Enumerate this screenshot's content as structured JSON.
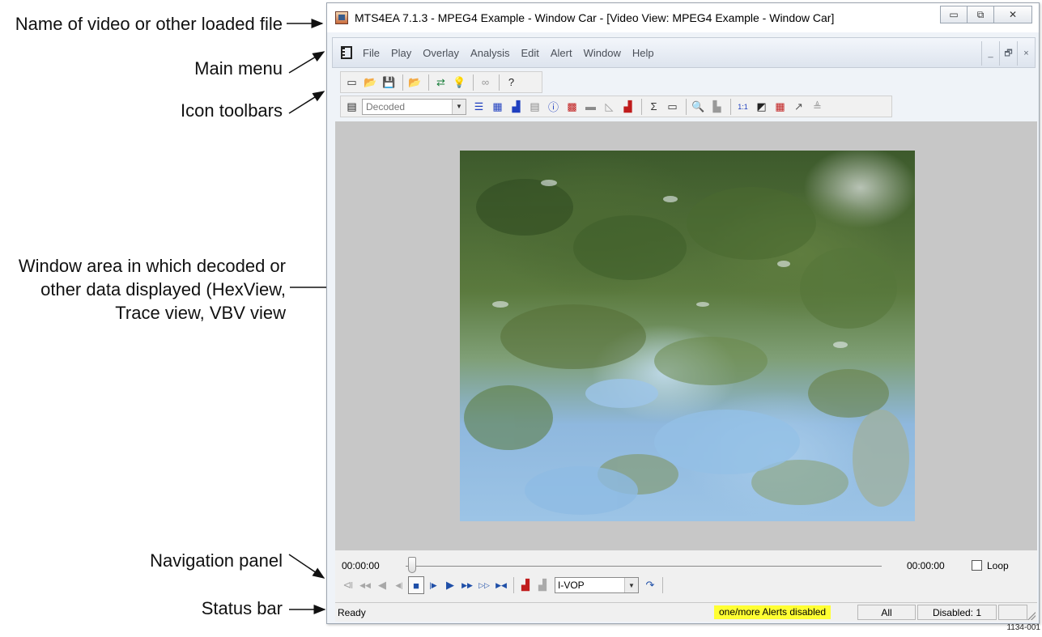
{
  "callouts": {
    "file_name": "Name of video or other loaded file",
    "main_menu": "Main menu",
    "icon_toolbars": "Icon toolbars",
    "window_area": [
      "Window area in which decoded or",
      "other data displayed (HexView,",
      "Trace view, VBV view"
    ],
    "navigation_panel": "Navigation panel",
    "status_bar": "Status bar"
  },
  "figure_id": "1134-001",
  "window": {
    "title": "MTS4EA 7.1.3 - MPEG4 Example - Window Car - [Video View: MPEG4 Example - Window Car]",
    "controls": {
      "minimize": "▭",
      "restore": "⧉",
      "close": "✕"
    }
  },
  "menu": {
    "items": [
      "File",
      "Play",
      "Overlay",
      "Analysis",
      "Edit",
      "Alert",
      "Window",
      "Help"
    ],
    "mdi_controls": {
      "minimize": "_",
      "restore": "🗗",
      "close": "×"
    }
  },
  "toolbar1": {
    "icons": [
      {
        "name": "new-file-icon",
        "glyph": "▭",
        "color": "#333333"
      },
      {
        "name": "open-folder-icon",
        "glyph": "📂",
        "color": "#333333"
      },
      {
        "name": "save-icon",
        "glyph": "💾",
        "color": "#222222"
      },
      {
        "name": "open-stream-icon",
        "glyph": "📂",
        "color": "#333333"
      },
      {
        "name": "compare-arrows-icon",
        "glyph": "⇄",
        "color": "#1a7f3c"
      },
      {
        "name": "bulb-icon",
        "glyph": "💡",
        "color": "#c9a400"
      },
      {
        "name": "link-icon",
        "glyph": "∞",
        "color": "#999999"
      },
      {
        "name": "help-icon",
        "glyph": "?",
        "color": "#222222"
      }
    ]
  },
  "toolbar2": {
    "view_select": {
      "value": "Decoded",
      "options_arrow": "▼"
    },
    "icons": [
      {
        "name": "list-view-icon",
        "glyph": "☰",
        "color": "#1f3fbf"
      },
      {
        "name": "hex-view-icon",
        "glyph": "▦",
        "color": "#1f3fbf"
      },
      {
        "name": "bits-chart-icon",
        "glyph": "▟",
        "color": "#1f3fbf"
      },
      {
        "name": "frame-grid-icon",
        "glyph": "▤",
        "color": "#888888"
      },
      {
        "name": "info-icon",
        "glyph": "ⓘ",
        "color": "#1f3fbf"
      },
      {
        "name": "macroblock-icon",
        "glyph": "▩",
        "color": "#c01c1c"
      },
      {
        "name": "layers-icon",
        "glyph": "▬",
        "color": "#8a8a8a"
      },
      {
        "name": "line-chart-icon",
        "glyph": "◺",
        "color": "#999999"
      },
      {
        "name": "bar-chart-icon",
        "glyph": "▟",
        "color": "#c01c1c"
      },
      {
        "name": "sigma-icon",
        "glyph": "Σ",
        "color": "#333333"
      },
      {
        "name": "comment-icon",
        "glyph": "▭",
        "color": "#333333"
      },
      {
        "name": "zoom-icon",
        "glyph": "🔍",
        "color": "#333333"
      },
      {
        "name": "factory-icon",
        "glyph": "▙",
        "color": "#999999"
      },
      {
        "name": "actual-size-icon",
        "glyph": "1:1",
        "color": "#1f3fbf"
      },
      {
        "name": "invert-icon",
        "glyph": "◩",
        "color": "#222222"
      },
      {
        "name": "red-grid-icon",
        "glyph": "▦",
        "color": "#c01c1c"
      },
      {
        "name": "export-icon",
        "glyph": "↗",
        "color": "#555555"
      },
      {
        "name": "print-icon",
        "glyph": "≜",
        "color": "#999999"
      }
    ]
  },
  "navigation": {
    "time_start": "00:00:00",
    "time_end": "00:00:00",
    "position": 0,
    "loop_label": "Loop",
    "loop_checked": false,
    "buttons": [
      {
        "name": "go-to-start-button",
        "glyph": "⧏",
        "dim": true
      },
      {
        "name": "rewind-fast-button",
        "glyph": "◀◀",
        "dim": true
      },
      {
        "name": "rewind-button",
        "glyph": "◀",
        "dim": true
      },
      {
        "name": "step-back-button",
        "glyph": "◀|",
        "dim": true
      },
      {
        "name": "stop-button",
        "glyph": "■",
        "stop": true
      },
      {
        "name": "step-forward-button",
        "glyph": "|▶"
      },
      {
        "name": "play-button",
        "glyph": "▶"
      },
      {
        "name": "fast-forward-button",
        "glyph": "▶▶"
      },
      {
        "name": "slow-forward-button",
        "glyph": "▷▷"
      },
      {
        "name": "go-to-end-button",
        "glyph": "▶◀"
      }
    ],
    "frame_buttons": [
      {
        "name": "frame-bits-button",
        "glyph": "▟"
      },
      {
        "name": "frame-chart-button",
        "glyph": "▟",
        "dim": true
      }
    ],
    "vop_select": {
      "value": "I-VOP",
      "options_arrow": "▼"
    },
    "jump_button": {
      "name": "jump-to-vop-button",
      "glyph": "↷"
    }
  },
  "status": {
    "ready": "Ready",
    "alert": "one/more Alerts disabled",
    "alert_color": "#ffff33",
    "all": "All",
    "disabled": "Disabled: 1",
    "empty": ""
  }
}
